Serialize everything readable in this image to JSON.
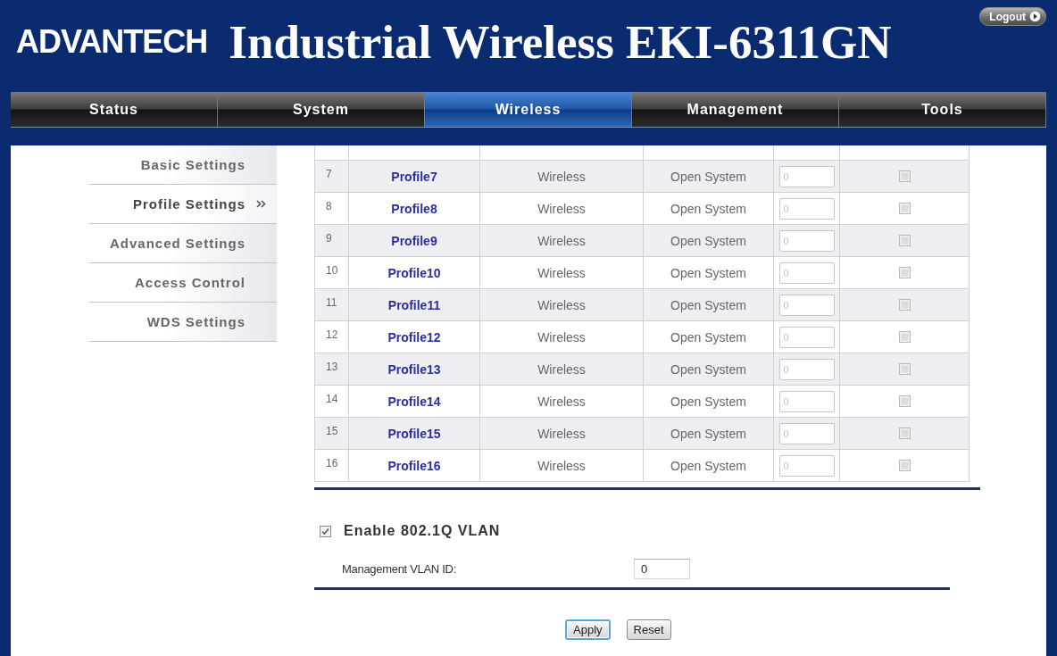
{
  "header": {
    "logo": "ADVANTECH",
    "title": "Industrial Wireless EKI-6311GN",
    "logout": "Logout"
  },
  "tabs": [
    {
      "label": "Status",
      "selected": false
    },
    {
      "label": "System",
      "selected": false
    },
    {
      "label": "Wireless",
      "selected": true
    },
    {
      "label": "Management",
      "selected": false
    },
    {
      "label": "Tools",
      "selected": false
    }
  ],
  "sidebar": {
    "items": [
      {
        "label": "Basic Settings",
        "selected": false
      },
      {
        "label": "Profile Settings",
        "selected": true
      },
      {
        "label": "Advanced Settings",
        "selected": false
      },
      {
        "label": "Access Control",
        "selected": false
      },
      {
        "label": "WDS Settings",
        "selected": false
      }
    ]
  },
  "table": {
    "rows": [
      {
        "column_1": "7",
        "column_2": "Profile7",
        "column_3": "Wireless",
        "column_4": "Open System",
        "column_5": {
          "value": "0",
          "disabled": true
        },
        "column_6": {
          "checked": false,
          "disabled": true
        }
      },
      {
        "column_1": "8",
        "column_2": "Profile8",
        "column_3": "Wireless",
        "column_4": "Open System",
        "column_5": {
          "value": "0",
          "disabled": true
        },
        "column_6": {
          "checked": false,
          "disabled": true
        }
      },
      {
        "column_1": "9",
        "column_2": "Profile9",
        "column_3": "Wireless",
        "column_4": "Open System",
        "column_5": {
          "value": "0",
          "disabled": true
        },
        "column_6": {
          "checked": false,
          "disabled": true
        }
      },
      {
        "column_1": "10",
        "column_2": "Profile10",
        "column_3": "Wireless",
        "column_4": "Open System",
        "column_5": {
          "value": "0",
          "disabled": true
        },
        "column_6": {
          "checked": false,
          "disabled": true
        }
      },
      {
        "column_1": "11",
        "column_2": "Profile11",
        "column_3": "Wireless",
        "column_4": "Open System",
        "column_5": {
          "value": "0",
          "disabled": true
        },
        "column_6": {
          "checked": false,
          "disabled": true
        }
      },
      {
        "column_1": "12",
        "column_2": "Profile12",
        "column_3": "Wireless",
        "column_4": "Open System",
        "column_5": {
          "value": "0",
          "disabled": true
        },
        "column_6": {
          "checked": false,
          "disabled": true
        }
      },
      {
        "column_1": "13",
        "column_2": "Profile13",
        "column_3": "Wireless",
        "column_4": "Open System",
        "column_5": {
          "value": "0",
          "disabled": true
        },
        "column_6": {
          "checked": false,
          "disabled": true
        }
      },
      {
        "column_1": "14",
        "column_2": "Profile14",
        "column_3": "Wireless",
        "column_4": "Open System",
        "column_5": {
          "value": "0",
          "disabled": true
        },
        "column_6": {
          "checked": false,
          "disabled": true
        }
      },
      {
        "column_1": "15",
        "column_2": "Profile15",
        "column_3": "Wireless",
        "column_4": "Open System",
        "column_5": {
          "value": "0",
          "disabled": true
        },
        "column_6": {
          "checked": false,
          "disabled": true
        }
      },
      {
        "column_1": "16",
        "column_2": "Profile16",
        "column_3": "Wireless",
        "column_4": "Open System",
        "column_5": {
          "value": "0",
          "disabled": true
        },
        "column_6": {
          "checked": false,
          "disabled": true
        }
      }
    ]
  },
  "vlan": {
    "enable_label": "Enable 802.1Q VLAN",
    "checked": true,
    "id_label": "Management VLAN ID:",
    "id_value": "0"
  },
  "buttons": [
    {
      "label": "Apply",
      "focused": true
    },
    {
      "label": "Reset",
      "focused": false
    }
  ]
}
